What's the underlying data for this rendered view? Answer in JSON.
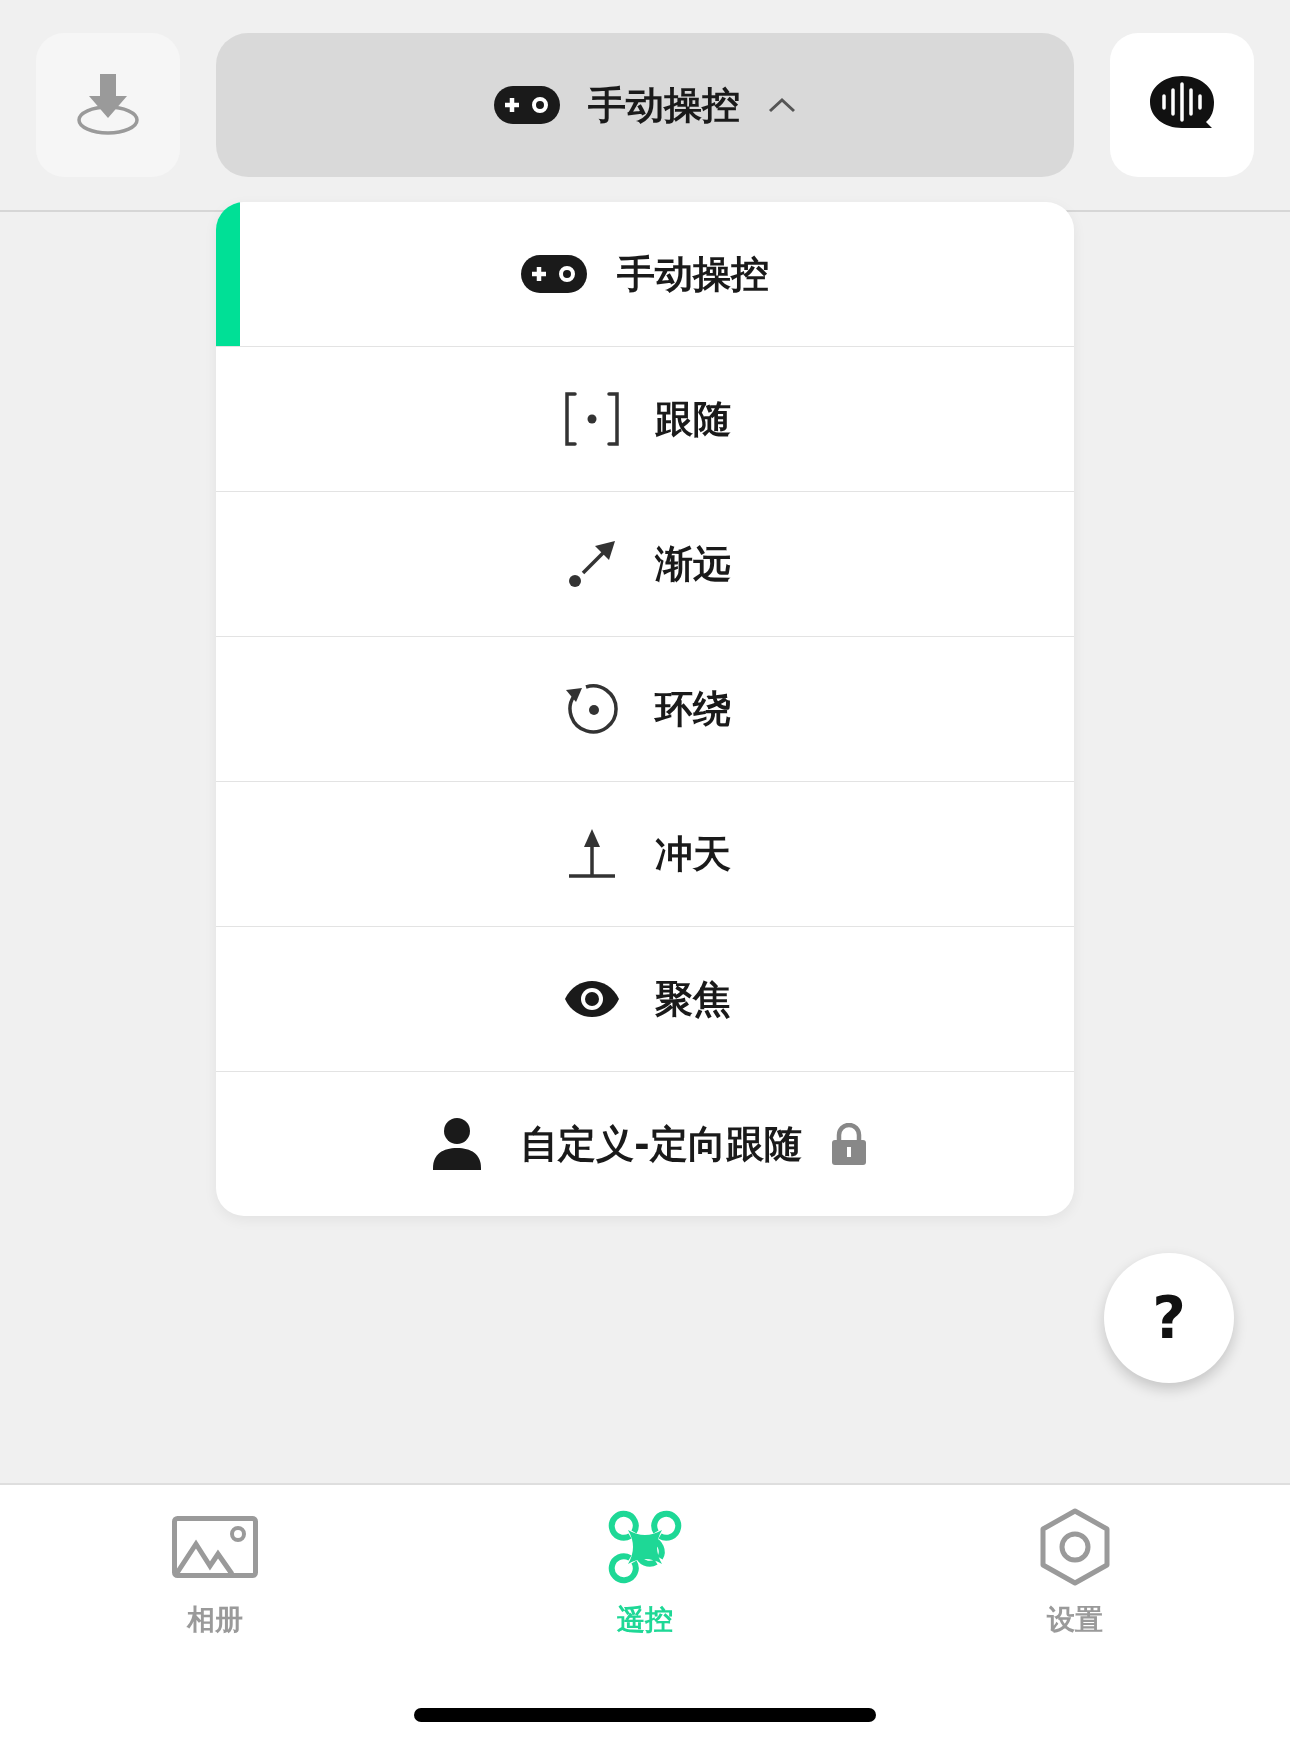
{
  "header": {
    "mode_button": {
      "label": "手动操控",
      "kind": "manual",
      "expanded": true
    }
  },
  "mode_menu": [
    {
      "label": "手动操控",
      "kind": "manual",
      "selected": true,
      "locked": false
    },
    {
      "label": "跟随",
      "kind": "follow",
      "selected": false,
      "locked": false
    },
    {
      "label": "渐远",
      "kind": "away",
      "selected": false,
      "locked": false
    },
    {
      "label": "环绕",
      "kind": "orbit",
      "selected": false,
      "locked": false
    },
    {
      "label": "冲天",
      "kind": "rise",
      "selected": false,
      "locked": false
    },
    {
      "label": "聚焦",
      "kind": "focus",
      "selected": false,
      "locked": false
    },
    {
      "label": "自定义-定向跟随",
      "kind": "custom",
      "selected": false,
      "locked": true
    }
  ],
  "help_button": {
    "label": "?"
  },
  "tab_bar": [
    {
      "label": "相册",
      "kind": "album",
      "selected": false
    },
    {
      "label": "遥控",
      "kind": "remote",
      "selected": true
    },
    {
      "label": "设置",
      "kind": "settings",
      "selected": false
    }
  ]
}
